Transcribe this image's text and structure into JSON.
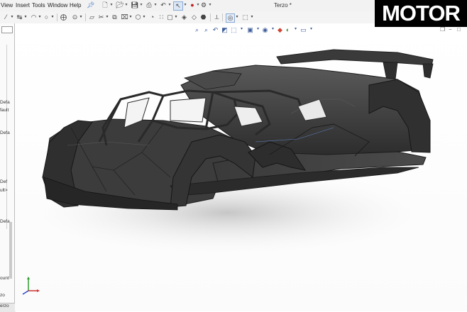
{
  "menu": {
    "view": "View",
    "insert": "Insert",
    "tools": "Tools",
    "window": "Window",
    "help": "Help"
  },
  "document_title": "Terzo *",
  "left_panel": {
    "fragments": [
      "Defa",
      "fault",
      "Defa",
      "Def",
      "ult>",
      "Defa",
      "ount",
      "zo"
    ],
    "bottom_tab": "erzo"
  },
  "logo": {
    "text": "MOTOR"
  },
  "icons": {
    "menubar": [
      "pin-icon",
      "new-document-icon",
      "open-icon",
      "save-icon",
      "print-icon",
      "undo-icon",
      "select-icon",
      "traffic-light-icon",
      "options-icon"
    ],
    "heads_up": [
      "zoom-to-fit-icon",
      "zoom-area-icon",
      "previous-view-icon",
      "section-view-icon",
      "view-orientation-icon",
      "display-style-icon",
      "hide-show-icon",
      "appearance-icon",
      "scene-icon",
      "display-settings-icon"
    ]
  },
  "colors": {
    "car_body": "#3b3b3b",
    "car_edge": "#222222",
    "viewport_bg": "#ffffff",
    "logo_bg": "#000000",
    "triad_x": "#d03030",
    "triad_y": "#2e9a2e",
    "triad_z": "#2e47c8"
  }
}
